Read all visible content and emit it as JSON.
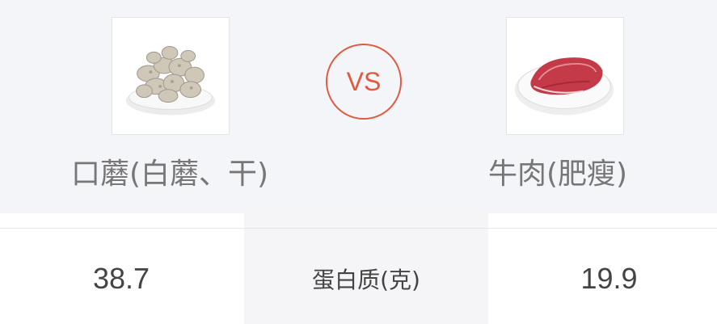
{
  "comparison": {
    "left": {
      "name": "口蘑(白蘑、干)",
      "image": "dried-mushrooms-photo"
    },
    "vs_label": "VS",
    "right": {
      "name": "牛肉(肥瘦)",
      "image": "raw-beef-photo"
    }
  },
  "nutrient_row": {
    "metric": "蛋白质(克)",
    "left_value": "38.7",
    "right_value": "19.9"
  },
  "colors": {
    "accent": "#e05a40",
    "header_bg": "#f4f5f9",
    "metric_bg": "#f5f5f7",
    "name_text": "#777777",
    "value_text": "#444444"
  }
}
